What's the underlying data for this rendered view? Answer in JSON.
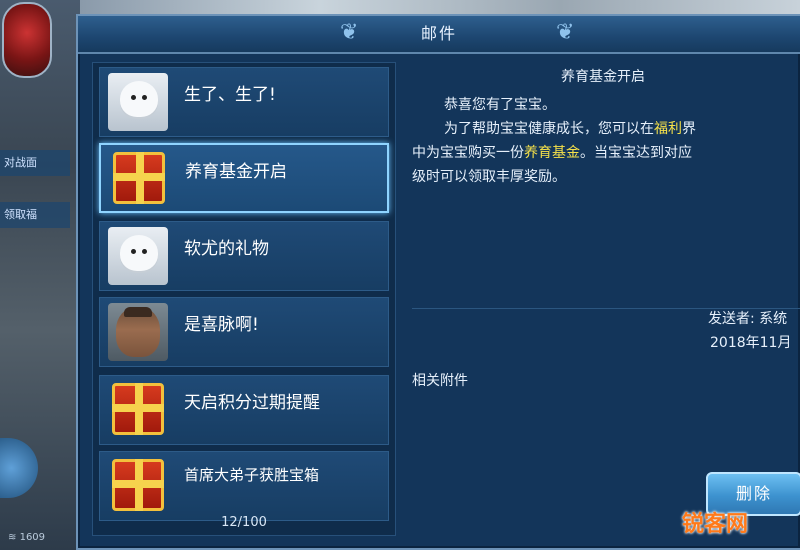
{
  "window": {
    "title": "邮件"
  },
  "mail_list": {
    "items": [
      {
        "title": "生了、生了!",
        "icon": "ghost-pet-icon"
      },
      {
        "title": "养育基金开启",
        "icon": "gift-box-icon",
        "selected": true
      },
      {
        "title": "软尤的礼物",
        "icon": "ghost-pet-icon"
      },
      {
        "title": "是喜脉啊!",
        "icon": "old-man-portrait-icon"
      },
      {
        "title": "天启积分过期提醒",
        "icon": "gift-box-icon"
      },
      {
        "title": "首席大弟子获胜宝箱",
        "icon": "gift-box-icon"
      }
    ],
    "count": "12/100"
  },
  "mail_detail": {
    "subject": "养育基金开启",
    "line1": "恭喜您有了宝宝。",
    "line2_a": "为了帮助宝宝健康成长，您可以在",
    "line2_hl": "福利",
    "line2_b": "界",
    "line3_a": "中为宝宝购买一份",
    "line3_hl": "养育基金",
    "line3_b": "。当宝宝达到对应",
    "line4": "级时可以领取丰厚奖励。",
    "sender": "发送者: 系统",
    "date": "2018年11月",
    "attachments_label": "相关附件",
    "delete_label": "删除",
    "highlight_color": "#f5e14a"
  },
  "hud": {
    "left_label_1": "对战面",
    "left_label_2": "领取福",
    "network": "1609"
  },
  "watermark": "锐客网"
}
